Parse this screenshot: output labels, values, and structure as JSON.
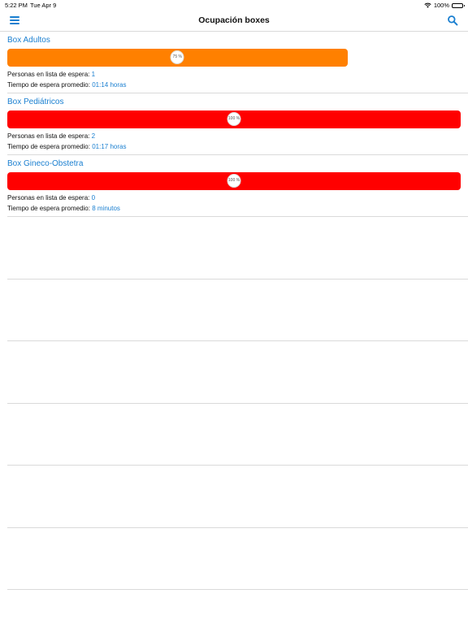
{
  "status": {
    "time": "5:22 PM",
    "date": "Tue Apr 9",
    "battery": "100%"
  },
  "nav": {
    "title": "Ocupación boxes"
  },
  "labels": {
    "waiting": "Personas en lista de espera:",
    "avg_time": "Tiempo de espera promedio:"
  },
  "colors": {
    "accent": "#1a7fd0",
    "orange": "#ff8000",
    "red": "#ff0000"
  },
  "boxes": [
    {
      "name": "Box Adultos",
      "occupancy": 75,
      "pct_label": "75 %",
      "color": "#ff8000",
      "waiting": "1",
      "avg_time": "01:14 horas"
    },
    {
      "name": "Box Pediátricos",
      "occupancy": 100,
      "pct_label": "100 %",
      "color": "#ff0000",
      "waiting": "2",
      "avg_time": "01:17 horas"
    },
    {
      "name": "Box Gineco-Obstetra",
      "occupancy": 100,
      "pct_label": "100 %",
      "color": "#ff0000",
      "waiting": "0",
      "avg_time": "8 minutos"
    }
  ]
}
